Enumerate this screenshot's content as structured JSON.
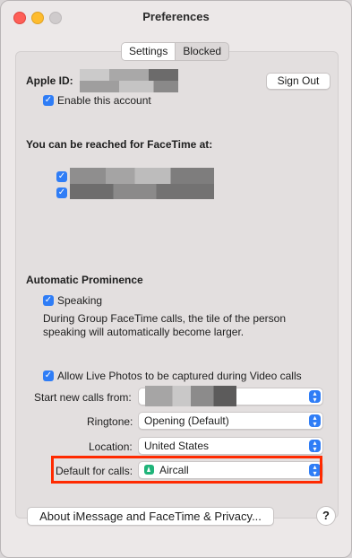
{
  "window": {
    "title": "Preferences"
  },
  "tabs": [
    {
      "label": "Settings",
      "active": true
    },
    {
      "label": "Blocked",
      "active": false
    }
  ],
  "account": {
    "apple_id_label": "Apple ID:",
    "sign_out_label": "Sign Out",
    "enable_account_label": "Enable this account",
    "enable_account_checked": true
  },
  "reach": {
    "heading": "You can be reached for FaceTime at:",
    "entries": [
      {
        "checked": true
      },
      {
        "checked": true
      }
    ]
  },
  "prominence": {
    "heading": "Automatic Prominence",
    "speaking_label": "Speaking",
    "speaking_checked": true,
    "description_line1": "During Group FaceTime calls, the tile of the person",
    "description_line2": "speaking will automatically become larger."
  },
  "live_photos": {
    "label": "Allow Live Photos to be captured during Video calls",
    "checked": true
  },
  "settings": {
    "start_calls_label": "Start new calls from:",
    "ringtone_label": "Ringtone:",
    "ringtone_value": "Opening (Default)",
    "location_label": "Location:",
    "location_value": "United States",
    "default_calls_label": "Default for calls:",
    "default_calls_value": "Aircall",
    "default_calls_icon": "aircall-icon"
  },
  "footer": {
    "privacy_button_label": "About iMessage and FaceTime & Privacy...",
    "help_label": "?"
  },
  "colors": {
    "accent": "#2f7df6",
    "highlight": "#ff2a00",
    "aircall": "#20b47a"
  }
}
